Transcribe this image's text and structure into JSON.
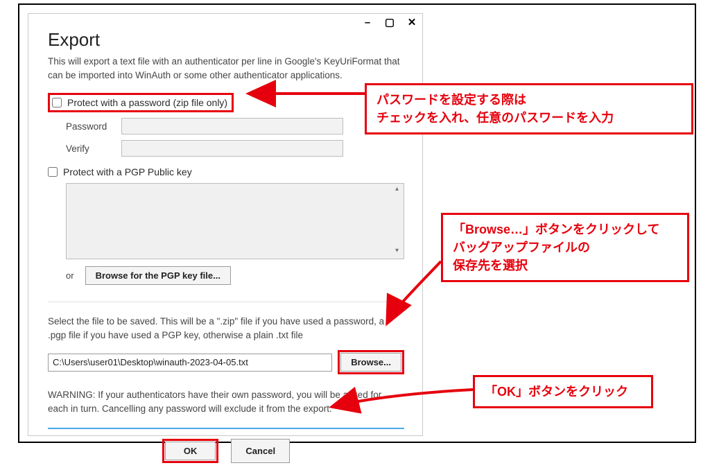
{
  "colors": {
    "accent_red": "#e6000d",
    "blue_line": "#4aa8e8"
  },
  "window": {
    "minimize_glyph": "–",
    "maximize_glyph": "▢",
    "close_glyph": "✕"
  },
  "dialog": {
    "title": "Export",
    "description": "This will export a text file with an authenticator per line in Google's KeyUriFormat that can be imported into WinAuth or some other authenticator applications.",
    "protect_password_label": "Protect with a password (zip file only)",
    "password_label": "Password",
    "verify_label": "Verify",
    "protect_pgp_label": "Protect with a PGP Public key",
    "or_text": "or",
    "browse_pgp_label": "Browse for the PGP key file...",
    "save_description": "Select the file to be saved. This will be a \".zip\" file if you have used a password, a .pgp file if you have used a PGP key, otherwise a plain .txt file",
    "path_value": "C:\\Users\\user01\\Desktop\\winauth-2023-04-05.txt",
    "browse_label": "Browse...",
    "warning": "WARNING: If your authenticators have their own password, you will be asked for each in turn. Cancelling any password will exclude it from the export.",
    "ok_label": "OK",
    "cancel_label": "Cancel"
  },
  "annotations": {
    "pwd_note": "パスワードを設定する際は\nチェックを入れ、任意のパスワードを入力",
    "browse_note": "「Browse…」ボタンをクリックして\nバッグアップファイルの\n保存先を選択",
    "ok_note": "「OK」ボタンをクリック"
  }
}
